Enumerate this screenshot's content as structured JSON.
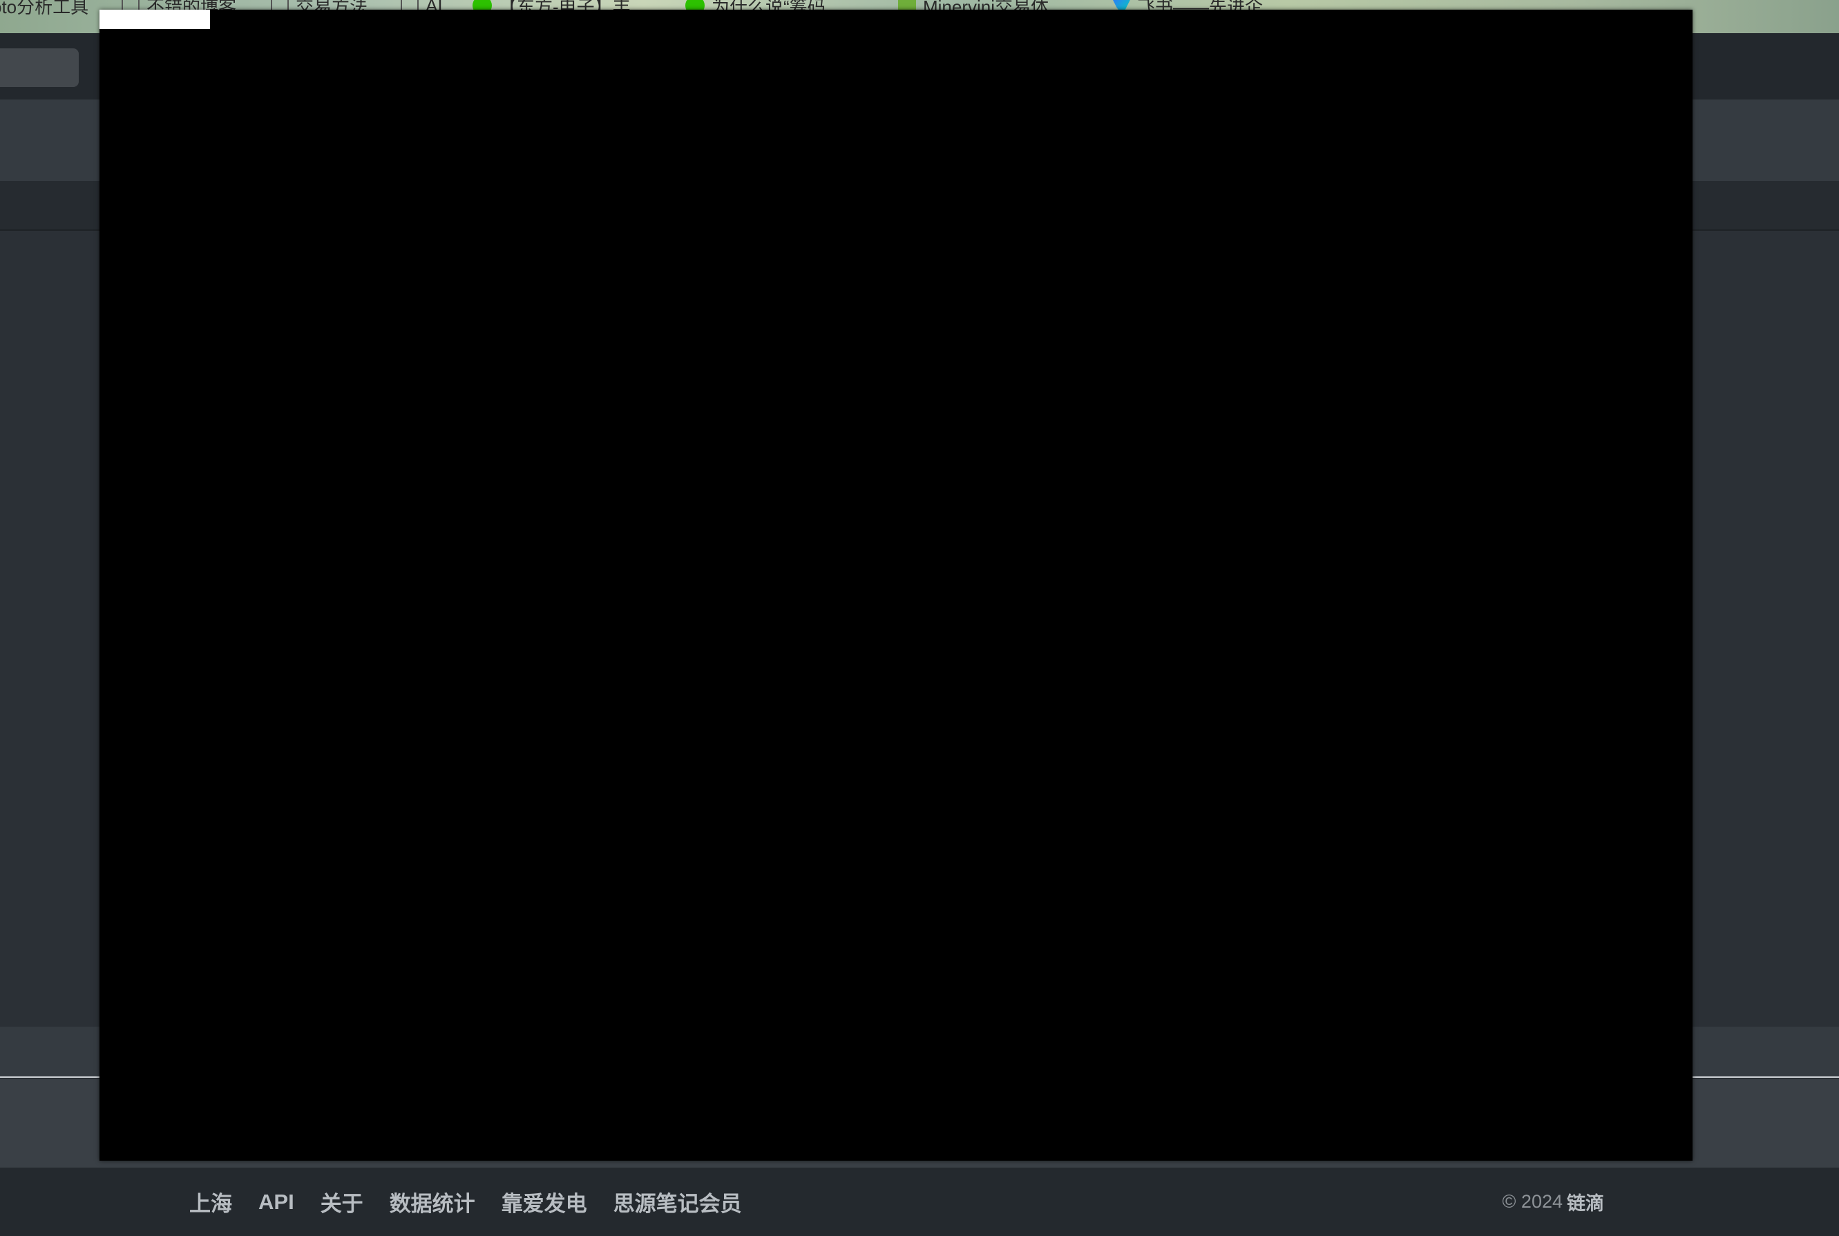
{
  "bookmarks": [
    {
      "label": "oto分析工具",
      "icon": "none"
    },
    {
      "label": "不错的博客",
      "icon": "folder-icon"
    },
    {
      "label": "交易方法",
      "icon": "folder-icon"
    },
    {
      "label": "AI",
      "icon": "folder-icon"
    },
    {
      "label": "【东方-电子】丰…",
      "icon": "wechat-icon"
    },
    {
      "label": "为什么说“筹码…",
      "icon": "wechat-icon"
    },
    {
      "label": "Minervini交易体…",
      "icon": "book-icon"
    },
    {
      "label": "飞书——先进企…",
      "icon": "feishu-icon"
    }
  ],
  "footer": {
    "links": [
      "上海",
      "API",
      "关于",
      "数据统计",
      "靠爱发电",
      "思源笔记会员"
    ],
    "copyright_prefix": "© 2024",
    "brand": "链滴"
  },
  "colors": {
    "overlay": "#000000",
    "footer_bg": "#24292e",
    "footer_link": "#b8bdc2"
  }
}
